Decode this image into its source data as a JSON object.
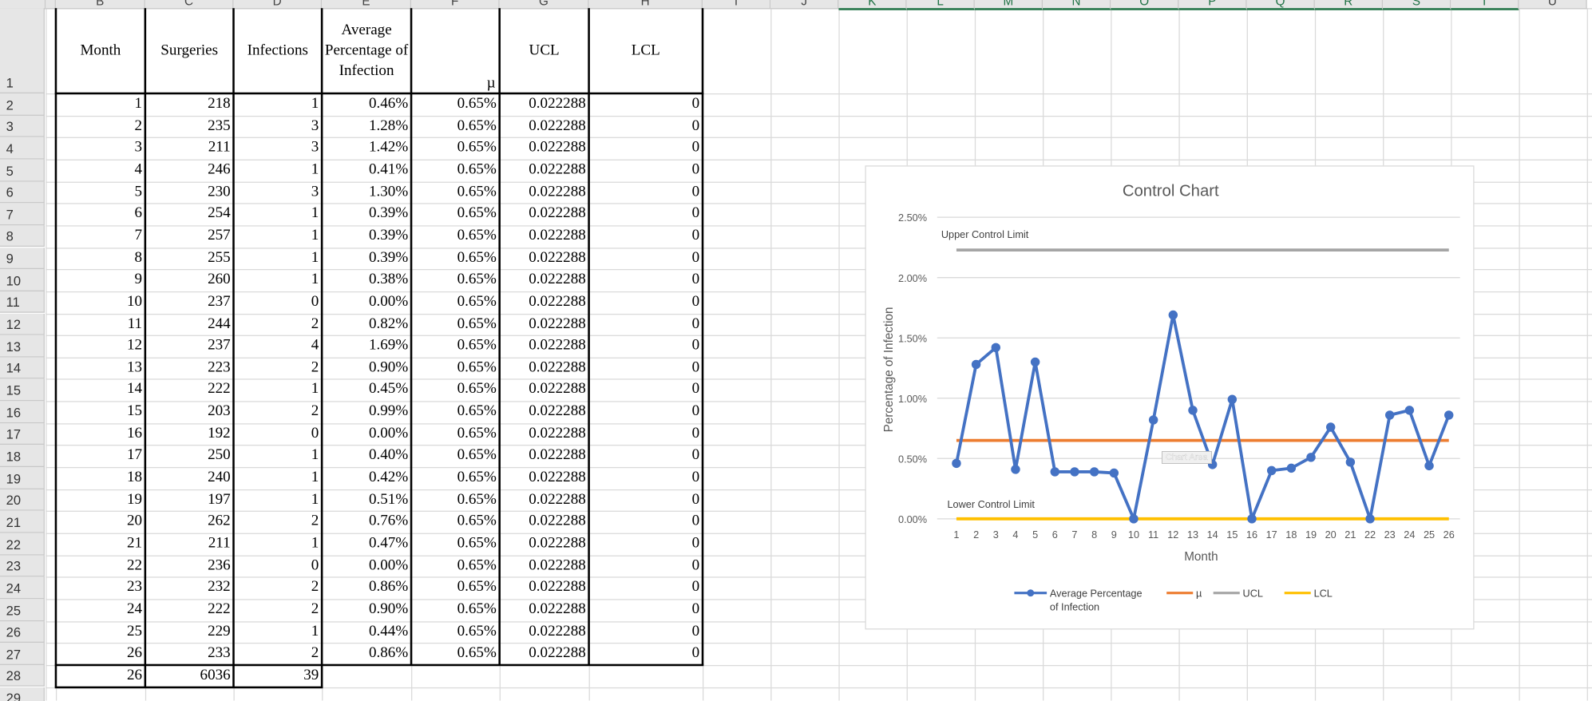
{
  "sheet": {
    "column_letters": [
      "B",
      "C",
      "D",
      "E",
      "F",
      "G",
      "H",
      "I",
      "J",
      "K",
      "L",
      "M",
      "N",
      "O",
      "P",
      "Q",
      "R",
      "S",
      "T",
      "U"
    ],
    "headers": {
      "month": "Month",
      "surgeries": "Surgeries",
      "infections": "Infections",
      "avg_pct": "Average Percentage of Infection",
      "mu": "µ",
      "ucl": "UCL",
      "lcl": "LCL"
    },
    "rows": [
      [
        "1",
        "218",
        "1",
        "0.46%",
        "0.65%",
        "0.022288",
        "0"
      ],
      [
        "2",
        "235",
        "3",
        "1.28%",
        "0.65%",
        "0.022288",
        "0"
      ],
      [
        "3",
        "211",
        "3",
        "1.42%",
        "0.65%",
        "0.022288",
        "0"
      ],
      [
        "4",
        "246",
        "1",
        "0.41%",
        "0.65%",
        "0.022288",
        "0"
      ],
      [
        "5",
        "230",
        "3",
        "1.30%",
        "0.65%",
        "0.022288",
        "0"
      ],
      [
        "6",
        "254",
        "1",
        "0.39%",
        "0.65%",
        "0.022288",
        "0"
      ],
      [
        "7",
        "257",
        "1",
        "0.39%",
        "0.65%",
        "0.022288",
        "0"
      ],
      [
        "8",
        "255",
        "1",
        "0.39%",
        "0.65%",
        "0.022288",
        "0"
      ],
      [
        "9",
        "260",
        "1",
        "0.38%",
        "0.65%",
        "0.022288",
        "0"
      ],
      [
        "10",
        "237",
        "0",
        "0.00%",
        "0.65%",
        "0.022288",
        "0"
      ],
      [
        "11",
        "244",
        "2",
        "0.82%",
        "0.65%",
        "0.022288",
        "0"
      ],
      [
        "12",
        "237",
        "4",
        "1.69%",
        "0.65%",
        "0.022288",
        "0"
      ],
      [
        "13",
        "223",
        "2",
        "0.90%",
        "0.65%",
        "0.022288",
        "0"
      ],
      [
        "14",
        "222",
        "1",
        "0.45%",
        "0.65%",
        "0.022288",
        "0"
      ],
      [
        "15",
        "203",
        "2",
        "0.99%",
        "0.65%",
        "0.022288",
        "0"
      ],
      [
        "16",
        "192",
        "0",
        "0.00%",
        "0.65%",
        "0.022288",
        "0"
      ],
      [
        "17",
        "250",
        "1",
        "0.40%",
        "0.65%",
        "0.022288",
        "0"
      ],
      [
        "18",
        "240",
        "1",
        "0.42%",
        "0.65%",
        "0.022288",
        "0"
      ],
      [
        "19",
        "197",
        "1",
        "0.51%",
        "0.65%",
        "0.022288",
        "0"
      ],
      [
        "20",
        "262",
        "2",
        "0.76%",
        "0.65%",
        "0.022288",
        "0"
      ],
      [
        "21",
        "211",
        "1",
        "0.47%",
        "0.65%",
        "0.022288",
        "0"
      ],
      [
        "22",
        "236",
        "0",
        "0.00%",
        "0.65%",
        "0.022288",
        "0"
      ],
      [
        "23",
        "232",
        "2",
        "0.86%",
        "0.65%",
        "0.022288",
        "0"
      ],
      [
        "24",
        "222",
        "2",
        "0.90%",
        "0.65%",
        "0.022288",
        "0"
      ],
      [
        "25",
        "229",
        "1",
        "0.44%",
        "0.65%",
        "0.022288",
        "0"
      ],
      [
        "26",
        "233",
        "2",
        "0.86%",
        "0.65%",
        "0.022288",
        "0"
      ]
    ],
    "totals": [
      "26",
      "6036",
      "39"
    ]
  },
  "chart_data": {
    "type": "line",
    "title": "Control Chart",
    "xlabel": "Month",
    "ylabel": "Percentage of Infection",
    "x": [
      1,
      2,
      3,
      4,
      5,
      6,
      7,
      8,
      9,
      10,
      11,
      12,
      13,
      14,
      15,
      16,
      17,
      18,
      19,
      20,
      21,
      22,
      23,
      24,
      25,
      26
    ],
    "ylim": [
      0,
      0.025
    ],
    "yticks": [
      "0.00%",
      "0.50%",
      "1.00%",
      "1.50%",
      "2.00%",
      "2.50%"
    ],
    "grid": true,
    "legend_position": "bottom",
    "series": [
      {
        "name": "Average Percentage of Infection",
        "color": "#4472c4",
        "markers": true,
        "values": [
          0.0046,
          0.0128,
          0.0142,
          0.0041,
          0.013,
          0.0039,
          0.0039,
          0.0039,
          0.0038,
          0.0,
          0.0082,
          0.0169,
          0.009,
          0.0045,
          0.0099,
          0.0,
          0.004,
          0.0042,
          0.0051,
          0.0076,
          0.0047,
          0.0,
          0.0086,
          0.009,
          0.0044,
          0.0086
        ]
      },
      {
        "name": "µ",
        "color": "#ed7d31",
        "markers": false,
        "values": [
          0.0065
        ]
      },
      {
        "name": "UCL",
        "color": "#a5a5a5",
        "markers": false,
        "values": [
          0.022288
        ]
      },
      {
        "name": "LCL",
        "color": "#ffc000",
        "markers": false,
        "values": [
          0
        ]
      }
    ],
    "annotations": [
      "Upper Control Limit",
      "Lower Control Limit"
    ]
  },
  "tooltip": "Chart Area"
}
